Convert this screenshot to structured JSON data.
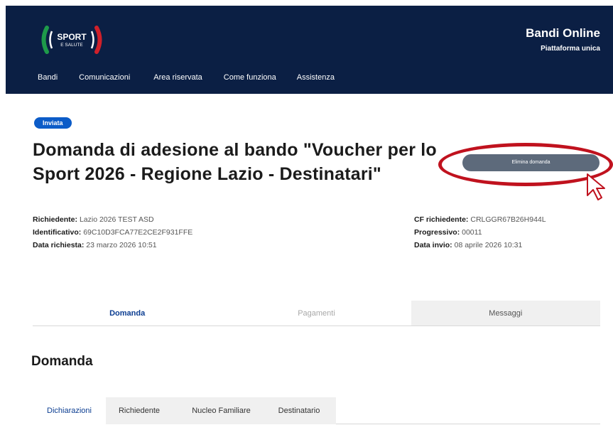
{
  "header": {
    "logo_text_top": "SPORT",
    "logo_text_bottom": "E SALUTE",
    "brand_title": "Bandi Online",
    "brand_subtitle": "Piattaforma unica",
    "nav": [
      "Bandi",
      "Comunicazioni",
      "Area riservata",
      "Come funziona",
      "Assistenza"
    ]
  },
  "status_badge": "Inviata",
  "page_title": "Domanda di adesione al bando \"Voucher per lo Sport 2026 - Regione Lazio - Destinatari\"",
  "actions": {
    "delete_label": "Elimina domanda"
  },
  "meta": {
    "left": [
      {
        "key": "Richiedente:",
        "value": "Lazio 2026 TEST ASD"
      },
      {
        "key": "Identificativo:",
        "value": "69C10D3FCA77E2CE2F931FFE"
      },
      {
        "key": "Data richiesta:",
        "value": "23 marzo 2026 10:51"
      }
    ],
    "right": [
      {
        "key": "CF richiedente:",
        "value": "CRLGGR67B26H944L"
      },
      {
        "key": "Progressivo:",
        "value": "00011"
      },
      {
        "key": "Data invio:",
        "value": "08 aprile 2026 10:31"
      }
    ]
  },
  "tabs": [
    "Domanda",
    "Pagamenti",
    "Messaggi"
  ],
  "section_title": "Domanda",
  "subtabs": [
    "Dichiarazioni",
    "Richiedente",
    "Nucleo Familiare",
    "Destinatario"
  ],
  "colors": {
    "header_bg": "#0b1f44",
    "badge_bg": "#0c5cc8",
    "button_bg": "#5d6a7b",
    "highlight": "#c0121e",
    "active_tab": "#0b3d91"
  }
}
